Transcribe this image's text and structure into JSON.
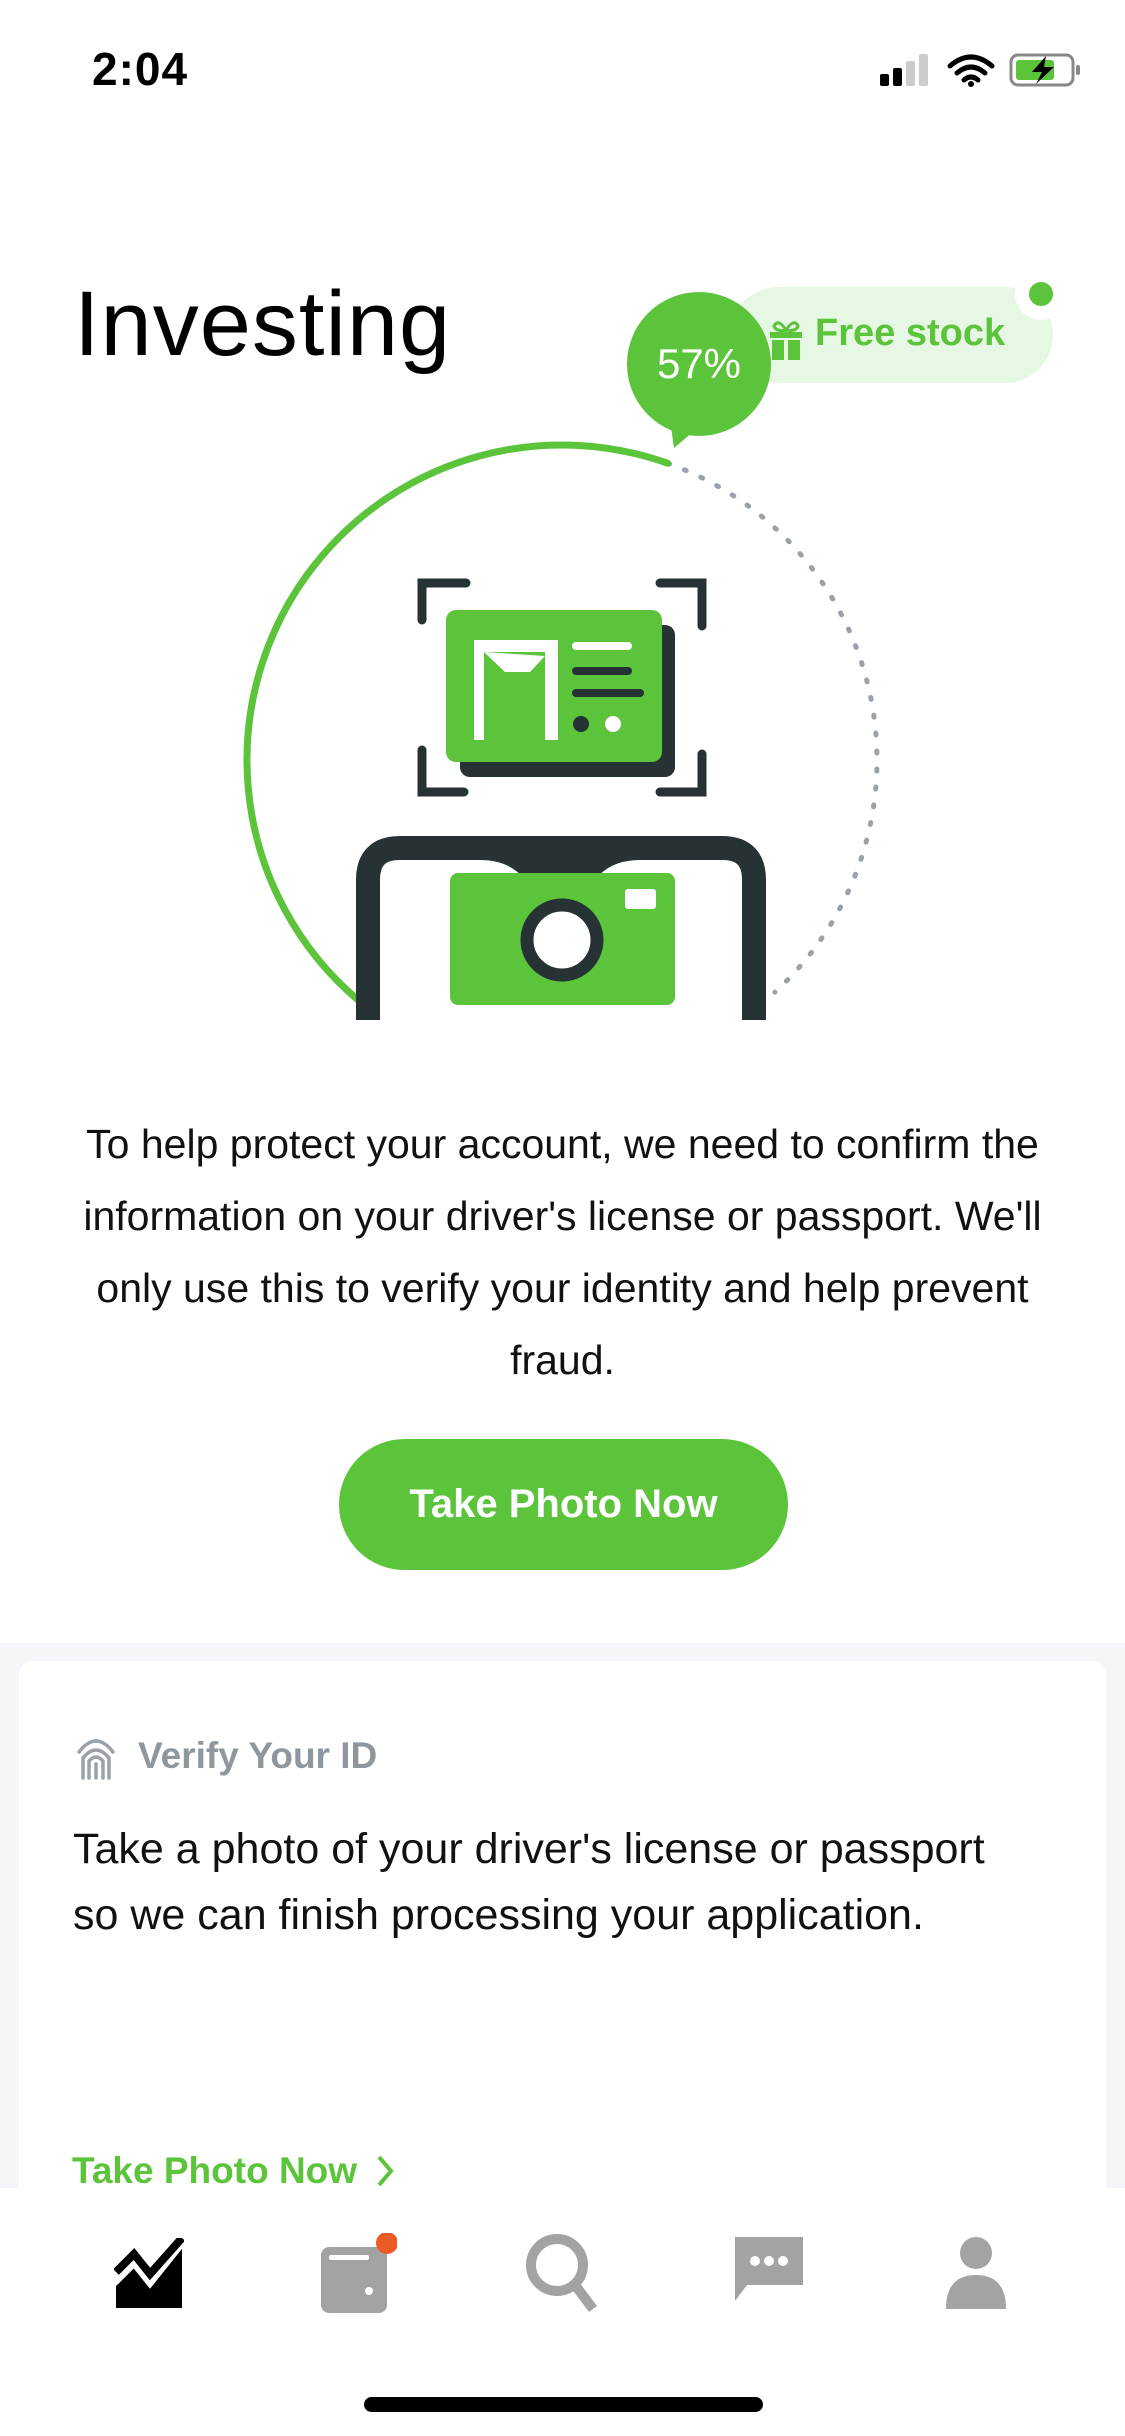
{
  "status_bar": {
    "time": "2:04",
    "signal_icon": "signal-icon",
    "wifi_icon": "wifi-icon",
    "battery_icon": "battery-charging-icon"
  },
  "header": {
    "title": "Investing"
  },
  "free_stock": {
    "label": "Free stock",
    "icon": "gift-icon",
    "has_notification": true
  },
  "progress": {
    "label": "57%",
    "value": 57
  },
  "main": {
    "description": "To help protect your account, we need to confirm the information on your driver's license or passport. We'll only use this to verify your identity and help prevent fraud.",
    "button_label": "Take Photo Now"
  },
  "card": {
    "heading": "Verify Your ID",
    "icon": "fingerprint-icon",
    "body": "Take a photo of your driver's license or passport so we can finish processing your application.",
    "link_label": "Take Photo Now"
  },
  "tabs": [
    {
      "icon": "chart-icon",
      "active": true
    },
    {
      "icon": "wallet-icon",
      "badge": true
    },
    {
      "icon": "search-icon"
    },
    {
      "icon": "messages-icon"
    },
    {
      "icon": "profile-icon"
    }
  ],
  "colors": {
    "accent": "#5bc43b",
    "dark": "#263233",
    "muted": "#9aa1a8",
    "badge": "#ea5b26"
  }
}
